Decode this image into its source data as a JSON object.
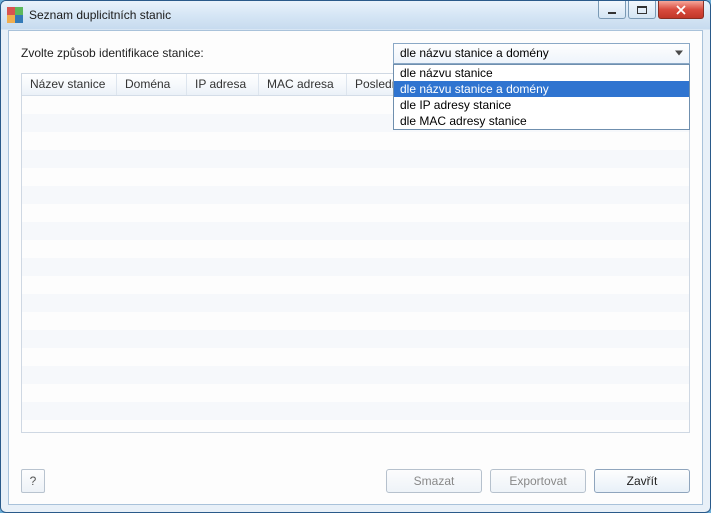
{
  "window": {
    "title": "Seznam duplicitních stanic"
  },
  "prompt": "Zvolte způsob identifikace stanice:",
  "combo": {
    "selected": "dle názvu stanice a domény",
    "options": [
      "dle názvu stanice",
      "dle názvu stanice a domény",
      "dle IP adresy stanice",
      "dle MAC adresy stanice"
    ],
    "selected_index": 1
  },
  "table": {
    "columns": [
      "Název stanice",
      "Doména",
      "IP adresa",
      "MAC adresa",
      "Poslední synchr..."
    ],
    "rows": []
  },
  "buttons": {
    "help": "?",
    "delete": "Smazat",
    "export": "Exportovat",
    "close": "Zavřít"
  }
}
